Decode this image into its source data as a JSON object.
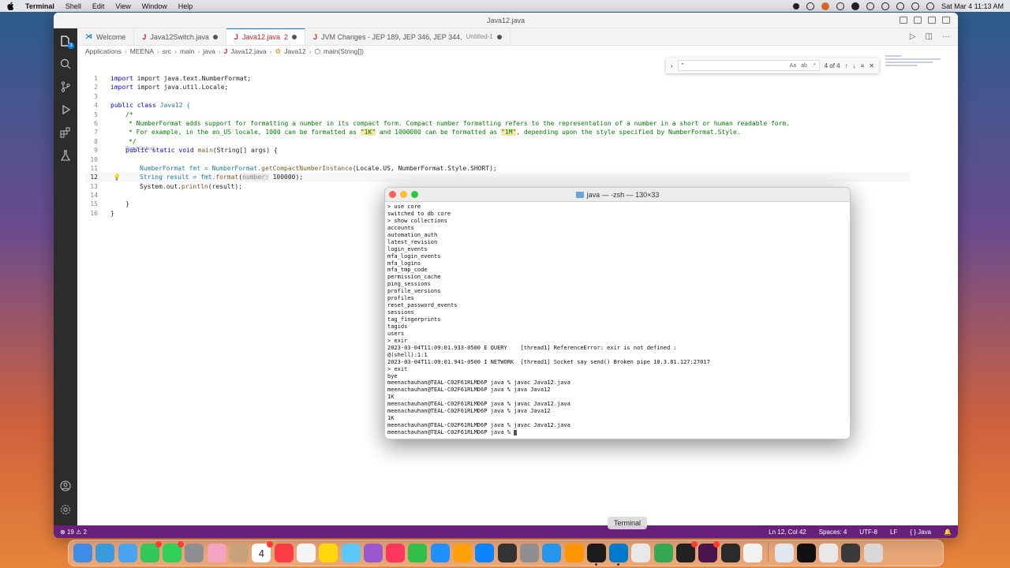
{
  "menubar": {
    "app": "Terminal",
    "items": [
      "Shell",
      "Edit",
      "View",
      "Window",
      "Help"
    ],
    "clock": "Sat Mar 4  11:13 AM"
  },
  "vscode": {
    "title": "Java12.java",
    "tabs": [
      {
        "label": "Welcome",
        "icon": "vscode-icon",
        "dirty": false,
        "active": false
      },
      {
        "label": "Java12Switch.java",
        "icon": "java-file-icon",
        "dirty": true,
        "active": false
      },
      {
        "label": "Java12.java",
        "suffix": "2",
        "icon": "java-file-icon",
        "dirty": true,
        "active": true
      },
      {
        "label": "JVM Changes - JEP 189, JEP 346, JEP 344,",
        "sub": "Untitled-1",
        "icon": "java-file-icon",
        "dirty": true,
        "active": false
      }
    ],
    "breadcrumb": [
      "Applications",
      "MEENA",
      "src",
      "main",
      "java",
      "Java12.java",
      "Java12",
      "main(String[])"
    ],
    "find": {
      "value": "\"",
      "options": [
        "Aa",
        "ab",
        ".*"
      ],
      "result": "4 of 4"
    },
    "codelens": "Run | Debug",
    "code": {
      "l1": "import java.text.NumberFormat;",
      "l2": "import java.util.Locale;",
      "l4_kw1": "public",
      "l4_kw2": "class",
      "l4_name": "Java12 {",
      "l5": "/*",
      "l6": "* NumberFormat adds support for formatting a number in its compact form. Compact number formatting refers to the representation of a number in a short or human readable form.",
      "l7a": "* For example, in the en_US locale, 1000 can be formatted as ",
      "l7b": "\"1K\"",
      "l7c": " and 1000000 can be formatted as ",
      "l7d": "\"1M\"",
      "l7e": ", depending upon the style specified by NumberFormat.Style.",
      "l8": "*/",
      "l9a": "public static void ",
      "l9b": "main",
      "l9c": "(String[] args) {",
      "l11a": "NumberFormat fmt = NumberFormat.",
      "l11b": "getCompactNumberInstance",
      "l11c": "(Locale.US, NumberFormat.Style.SHORT);",
      "l12a": "String result = fmt.",
      "l12b": "format",
      "l12c": "(",
      "l12hint": "number:",
      "l12d": " 100000);",
      "l13a": "System.out.",
      "l13b": "println",
      "l13c": "(result);",
      "l15": "}",
      "l16": "}"
    },
    "status": {
      "errors": "19",
      "warnings": "2",
      "position": "Ln 12, Col 42",
      "spaces": "Spaces: 4",
      "encoding": "UTF-8",
      "eol": "LF",
      "lang_braces": "{ }",
      "language": "Java"
    }
  },
  "terminal": {
    "title": "java — -zsh — 130×33",
    "lines": [
      "> use core",
      "switched to db core",
      "> show collections",
      "accounts",
      "automation_auth",
      "latest_revision",
      "login_events",
      "mfa_login_events",
      "mfa_logins",
      "mfa_tmp_code",
      "permission_cache",
      "ping_sessions",
      "profile_versions",
      "profiles",
      "reset_password_events",
      "sessions",
      "tag_fingerprints",
      "tagids",
      "users",
      "> exir",
      "2023-03-04T11:09:01.933-0500 E QUERY    [thread1] ReferenceError: exir is not defined :",
      "@(shell):1:1",
      "2023-03-04T11:09:01.941-0500 I NETWORK  [thread1] Socket say send() Broken pipe 10.3.81.127:27017",
      "> exit",
      "bye",
      "meenachauhan@TEAL-C02F61RLMD6P java % javac Java12.java",
      "meenachauhan@TEAL-C02F61RLMD6P java % java Java12",
      "1K",
      "meenachauhan@TEAL-C02F61RLMD6P java % javac Java12.java",
      "meenachauhan@TEAL-C02F61RLMD6P java % java Java12",
      "1K",
      "meenachauhan@TEAL-C02F61RLMD6P java % javac Java12.java"
    ],
    "prompt": "meenachauhan@TEAL-C02F61RLMD6P java % "
  },
  "dock": {
    "tooltip": "Terminal",
    "calendar_day": "4",
    "icons": [
      {
        "name": "finder-icon",
        "color": "#3d8ce8"
      },
      {
        "name": "safari-icon",
        "color": "#3a9bdc"
      },
      {
        "name": "mail-icon",
        "color": "#4aa3f0"
      },
      {
        "name": "facetime-icon",
        "color": "#34c759",
        "badge": true
      },
      {
        "name": "messages-icon",
        "color": "#30d158",
        "badge": true
      },
      {
        "name": "launchpad-icon",
        "color": "#8e8e93"
      },
      {
        "name": "photos-icon",
        "color": "#f4a3c0"
      },
      {
        "name": "contacts-icon",
        "color": "#c8a27a"
      },
      {
        "name": "calendar-icon",
        "color": "#ffffff",
        "badge": true
      },
      {
        "name": "music-icon",
        "color": "#fc3c44"
      },
      {
        "name": "reminders-icon",
        "color": "#f5f5f5"
      },
      {
        "name": "notes-icon",
        "color": "#ffd60a"
      },
      {
        "name": "freeform-icon",
        "color": "#5ac8fa"
      },
      {
        "name": "podcasts-icon",
        "color": "#9b59d0"
      },
      {
        "name": "news-icon",
        "color": "#ff375f"
      },
      {
        "name": "numbers-icon",
        "color": "#30c048"
      },
      {
        "name": "keynote-icon",
        "color": "#1e90ff"
      },
      {
        "name": "pages-icon",
        "color": "#ff9f0a"
      },
      {
        "name": "app-store-icon",
        "color": "#0a84ff"
      },
      {
        "name": "quicktime-icon",
        "color": "#333333"
      },
      {
        "name": "system-settings-icon",
        "color": "#8e8e93"
      },
      {
        "name": "docker-icon",
        "color": "#2496ed"
      },
      {
        "name": "home-icon",
        "color": "#ff9500"
      },
      {
        "name": "terminal-icon",
        "color": "#1c1c1e",
        "running": true
      },
      {
        "name": "vscode-icon",
        "color": "#007acc",
        "running": true
      },
      {
        "name": "network-radar-icon",
        "color": "#e8e8e8"
      },
      {
        "name": "chrome-icon",
        "color": "#34a853"
      },
      {
        "name": "intellij-icon",
        "color": "#222222",
        "badge": true
      },
      {
        "name": "slack-icon",
        "color": "#4a154b",
        "badge": true
      },
      {
        "name": "monitor-icon",
        "color": "#2b2b2b"
      },
      {
        "name": "textedit-icon",
        "color": "#f2f2f2"
      },
      {
        "name": "documents-folder-icon",
        "color": "#dfe6ee"
      },
      {
        "name": "window-thumb-1-icon",
        "color": "#111111"
      },
      {
        "name": "window-thumb-2-icon",
        "color": "#e8e8e8"
      },
      {
        "name": "window-thumb-3-icon",
        "color": "#3a3a3a"
      },
      {
        "name": "trash-icon",
        "color": "#d8d8d8"
      }
    ]
  }
}
